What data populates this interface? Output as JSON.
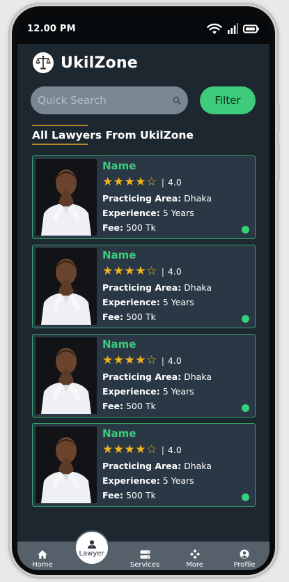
{
  "status_bar": {
    "time": "12.00 PM",
    "icons": [
      "wifi-icon",
      "signal-icon",
      "battery-icon"
    ]
  },
  "header": {
    "title": "UkilZone",
    "logo_icon": "scales-of-justice-icon"
  },
  "search": {
    "placeholder": "Quick Search",
    "icon": "search-icon"
  },
  "filter": {
    "label": "Filter"
  },
  "section": {
    "title": "All Lawyers From UkilZone"
  },
  "labels": {
    "practicing_area": "Practicing Area:",
    "experience": "Experience:",
    "fee": "Fee:"
  },
  "lawyers": [
    {
      "name": "Name",
      "rating": "4.0",
      "stars": "★★★★☆",
      "area": "Dhaka",
      "experience": "5 Years",
      "fee": "500 Tk",
      "online": true
    },
    {
      "name": "Name",
      "rating": "4.0",
      "stars": "★★★★☆",
      "area": "Dhaka",
      "experience": "5 Years",
      "fee": "500 Tk",
      "online": true
    },
    {
      "name": "Name",
      "rating": "4.0",
      "stars": "★★★★☆",
      "area": "Dhaka",
      "experience": "5 Years",
      "fee": "500 Tk",
      "online": true
    },
    {
      "name": "Name",
      "rating": "4.0",
      "stars": "★★★★☆",
      "area": "Dhaka",
      "experience": "5 Years",
      "fee": "500 Tk",
      "online": true
    }
  ],
  "nav": {
    "home": "Home",
    "lawyer": "Lawyer",
    "services": "Services",
    "more": "More",
    "profile": "Profile"
  },
  "colors": {
    "background": "#1d2730",
    "accent_green": "#3ecb7b",
    "star_gold": "#f1b21e",
    "card_border": "#35a56b",
    "nav_bar": "#55606b"
  }
}
